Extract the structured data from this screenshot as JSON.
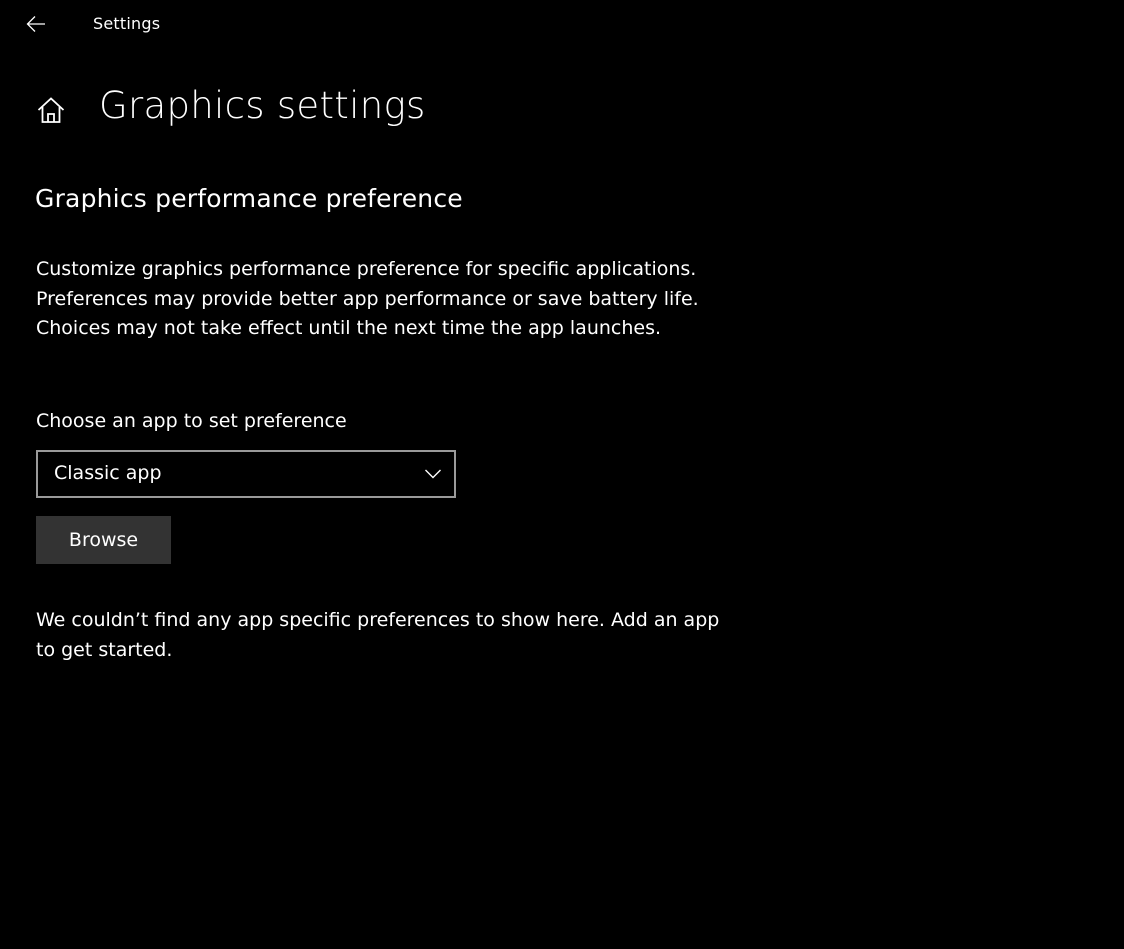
{
  "titlebar": {
    "back_icon": "back-arrow-icon",
    "app_title": "Settings"
  },
  "header": {
    "home_icon": "home-icon",
    "page_title": "Graphics settings"
  },
  "main": {
    "section_title": "Graphics performance preference",
    "description": "Customize graphics performance preference for specific applications. Preferences may provide better app performance or save battery life. Choices may not take effect until the next time the app launches.",
    "choose_label": "Choose an app to set preference",
    "app_type_select": {
      "selected": "Classic app",
      "chevron_icon": "chevron-down-icon"
    },
    "browse_label": "Browse",
    "empty_message": "We couldn’t find any app specific preferences to show here. Add an app to get started."
  },
  "colors": {
    "background": "#000000",
    "text": "#ffffff",
    "button_bg": "#333333",
    "dropdown_border": "#9a9a9a"
  }
}
